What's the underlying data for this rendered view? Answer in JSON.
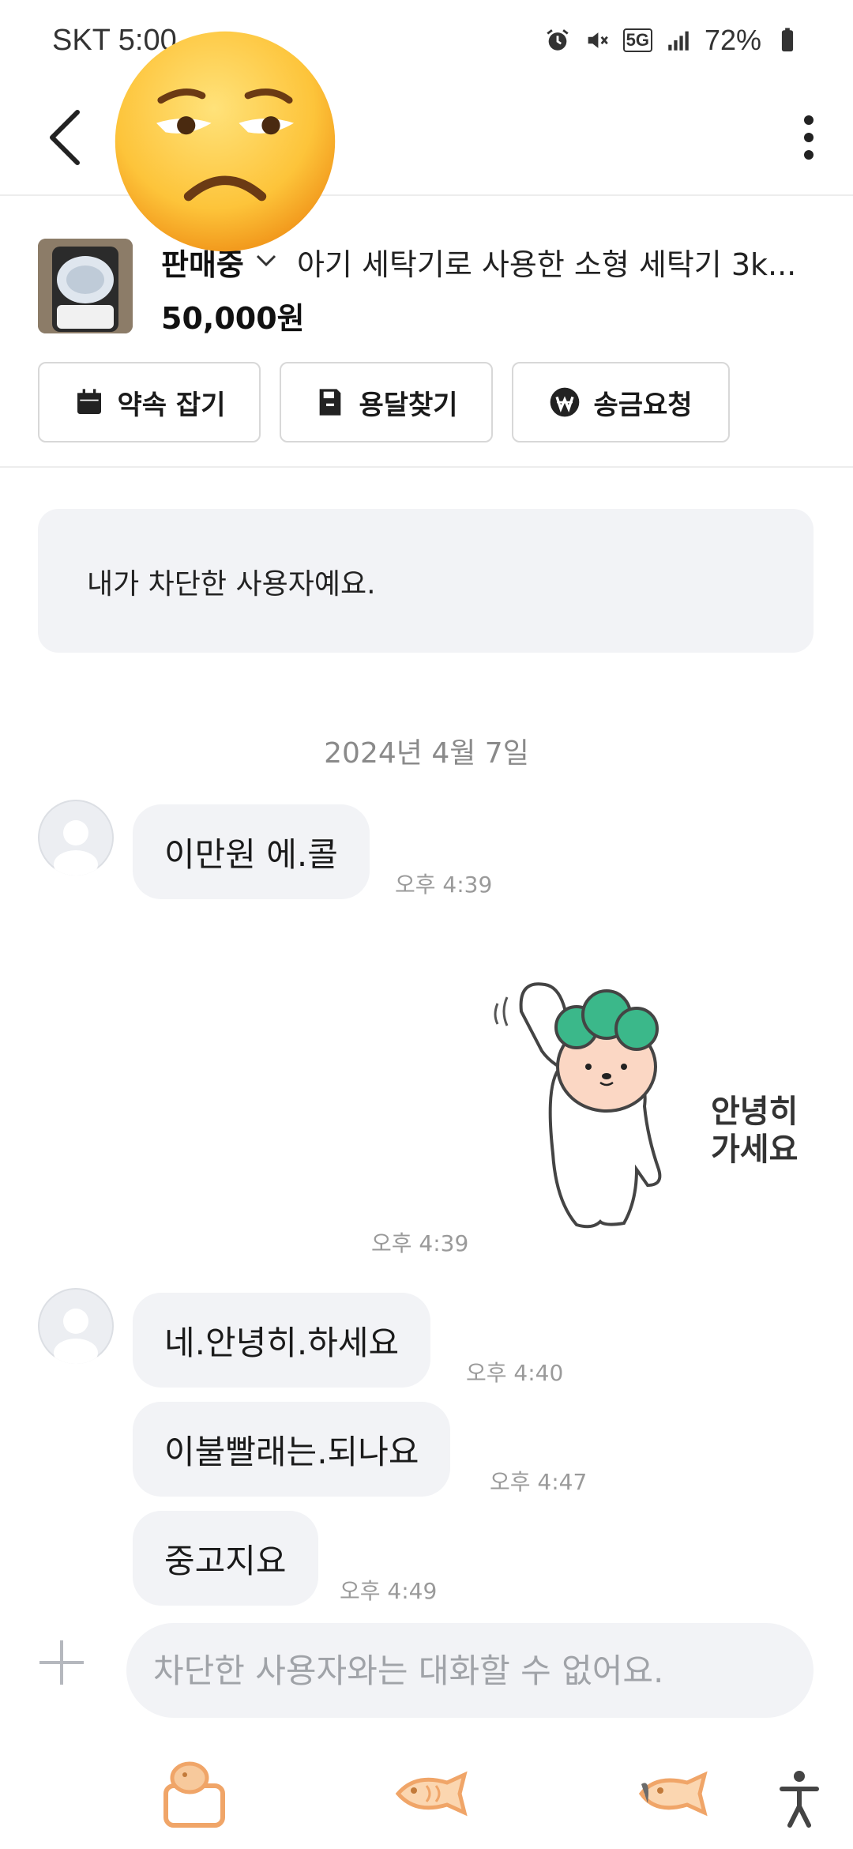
{
  "status_bar": {
    "carrier_time": "SKT 5:00",
    "network": "5G",
    "battery": "72%"
  },
  "product": {
    "status": "판매중",
    "title": "아기 세탁기로 사용한 소형 세탁기 3k...",
    "price": "50,000원"
  },
  "actions": [
    {
      "label": "약속 잡기",
      "icon": "calendar-icon"
    },
    {
      "label": "용달찾기",
      "icon": "truck-icon"
    },
    {
      "label": "송금요청",
      "icon": "won-icon"
    }
  ],
  "notice": "내가 차단한 사용자예요.",
  "date_separator": "2024년 4월 7일",
  "messages": [
    {
      "text": "이만원 에.콜",
      "time": "오후 4:39"
    },
    {
      "text": "네.안녕히.하세요",
      "time": "오후 4:40"
    },
    {
      "text": "이불빨래는.되나요",
      "time": "오후 4:47"
    },
    {
      "text": "중고지요",
      "time": "오후 4:49"
    }
  ],
  "sticker": {
    "text_line1": "안녕히",
    "text_line2": "가세요",
    "time": "오후 4:39"
  },
  "input": {
    "placeholder": "차단한 사용자와는 대화할 수 없어요."
  },
  "colors": {
    "bubble_bg": "#f2f3f6",
    "accent_orange": "#f0a568",
    "sticker_green": "#3bb88a"
  }
}
